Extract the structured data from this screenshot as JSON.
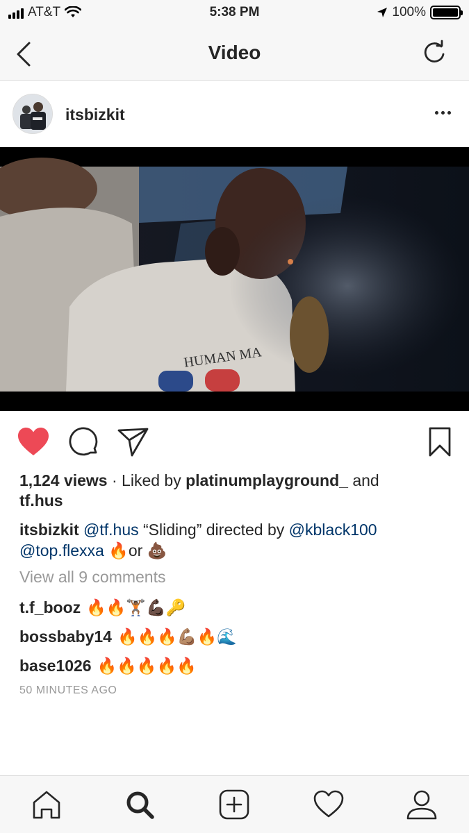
{
  "status_bar": {
    "carrier": "AT&T",
    "time": "5:38 PM",
    "battery": "100%"
  },
  "nav": {
    "title": "Video",
    "back_icon": "chevron-left-icon",
    "refresh_icon": "refresh-icon"
  },
  "post": {
    "username": "itsbizkit",
    "more_icon": "more-horizontal-icon",
    "liked": true,
    "like_color": "#ed4956",
    "views": "1,124 views",
    "liked_by_prefix": " · Liked by ",
    "liked_by_user1": "platinumplayground_",
    "liked_by_and": " and",
    "liked_by_user2": "tf.hus",
    "caption": {
      "author": "itsbizkit",
      "mention1": "@tf.hus",
      "text1": " “Sliding” directed by ",
      "mention2": "@kblack100",
      "mention3": "@top.flexxa",
      "emoji1": "🔥",
      "text2": "or ",
      "emoji2": "💩"
    },
    "view_all": "View all 9 comments",
    "comments": [
      {
        "user": "t.f_booz",
        "emojis": "🔥🔥🏋🏾💪🏿🔑"
      },
      {
        "user": "bossbaby14",
        "emojis": "🔥🔥🔥💪🏽🔥🌊"
      },
      {
        "user": "base1026",
        "emojis": "🔥🔥🔥🔥🔥"
      }
    ],
    "timestamp": "50 MINUTES AGO",
    "shirt_text": "HUMAN MA"
  },
  "tab_bar": {
    "items": [
      "home-icon",
      "search-icon",
      "add-post-icon",
      "activity-heart-icon",
      "profile-icon"
    ],
    "active": "search-icon"
  }
}
